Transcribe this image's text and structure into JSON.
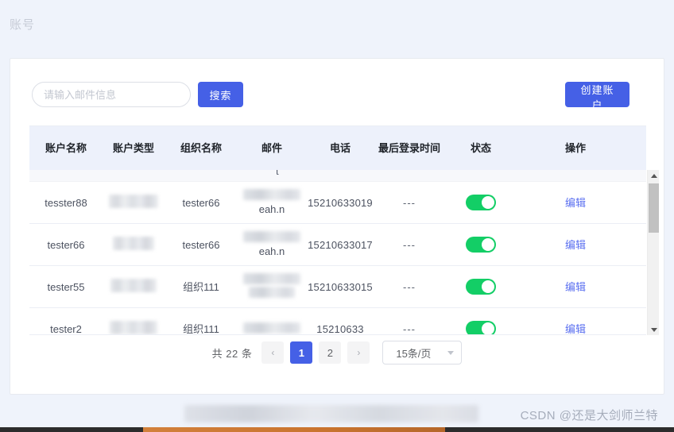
{
  "page": {
    "title": "账号",
    "background_color": "#eff3fb",
    "accent_color": "#4560e6",
    "switch_on_color": "#13ce66"
  },
  "toolbar": {
    "search_placeholder": "请输入邮件信息",
    "search_value": "",
    "search_label": "搜索",
    "create_label": "创建账户"
  },
  "table": {
    "columns": [
      {
        "key": "account_name",
        "label": "账户名称"
      },
      {
        "key": "account_type",
        "label": "账户类型"
      },
      {
        "key": "org_name",
        "label": "组织名称"
      },
      {
        "key": "email",
        "label": "邮件"
      },
      {
        "key": "phone",
        "label": "电话"
      },
      {
        "key": "last_login",
        "label": "最后登录时间"
      },
      {
        "key": "status",
        "label": "状态"
      },
      {
        "key": "action",
        "label": "操作"
      }
    ],
    "clipped_row_text": "t",
    "rows": [
      {
        "account_name": "tesster88",
        "account_type": "",
        "org_name": "tester66",
        "email_visible": "eah.n",
        "phone": "15210633019",
        "last_login": "---",
        "status_on": true,
        "action": "编辑"
      },
      {
        "account_name": "tester66",
        "account_type": "",
        "org_name": "tester66",
        "email_visible": "eah.n",
        "phone": "15210633017",
        "last_login": "---",
        "status_on": true,
        "action": "编辑"
      },
      {
        "account_name": "tester55",
        "account_type": "",
        "org_name": "组织111",
        "email_visible": "",
        "phone": "15210633015",
        "last_login": "---",
        "status_on": true,
        "action": "编辑"
      },
      {
        "account_name": "tester2",
        "account_type": "",
        "org_name": "组织111",
        "email_visible": "",
        "phone": "15210633",
        "last_login": "---",
        "status_on": true,
        "action": "编辑"
      }
    ]
  },
  "scrollbar": {
    "up_icon": "triangle-up-icon",
    "down_icon": "triangle-down-icon"
  },
  "pagination": {
    "total_text": "共 22 条",
    "prev": "‹",
    "next": "›",
    "pages": [
      "1",
      "2"
    ],
    "active_page": "1",
    "page_size": "15条/页"
  },
  "footer": {
    "watermark": "CSDN @还是大剑师兰特"
  }
}
